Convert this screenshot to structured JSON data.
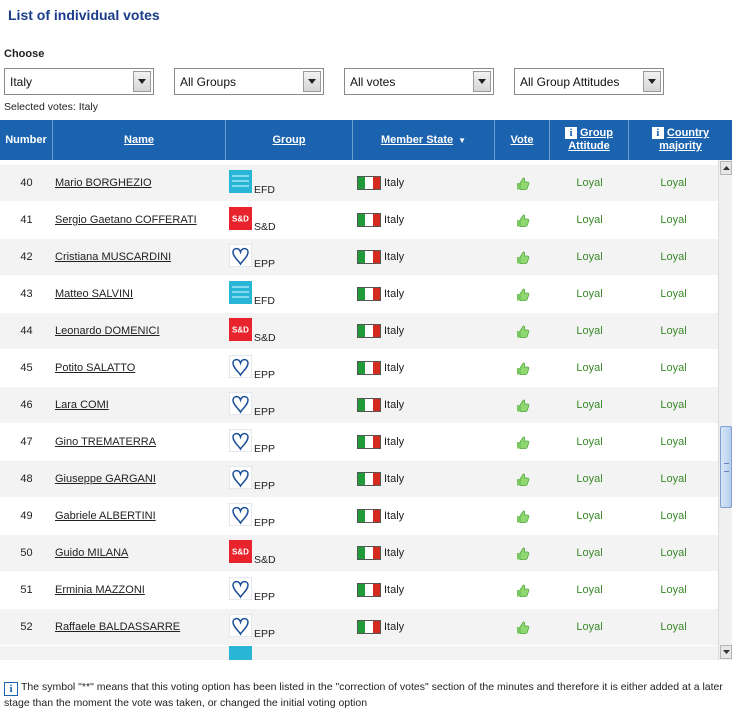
{
  "page": {
    "title": "List of individual votes",
    "choose_label": "Choose",
    "selected_votes": "Selected votes: Italy"
  },
  "filters": {
    "member_state": "Italy",
    "group": "All Groups",
    "votes": "All votes",
    "attitude": "All Group Attitudes"
  },
  "columns": {
    "number": "Number",
    "name": "Name",
    "group": "Group",
    "member_state": "Member State",
    "vote": "Vote",
    "group_attitude": "Group Attitude",
    "country_majority": "Country majority"
  },
  "rows": [
    {
      "number": "40",
      "name": "Mario BORGHEZIO",
      "group": "EFD",
      "member_state": "Italy",
      "vote": "thumbs-up",
      "group_attitude": "Loyal",
      "country_majority": "Loyal"
    },
    {
      "number": "41",
      "name": "Sergio Gaetano COFFERATI",
      "group": "S&D",
      "member_state": "Italy",
      "vote": "thumbs-up",
      "group_attitude": "Loyal",
      "country_majority": "Loyal"
    },
    {
      "number": "42",
      "name": "Cristiana MUSCARDINI",
      "group": "EPP",
      "member_state": "Italy",
      "vote": "thumbs-up",
      "group_attitude": "Loyal",
      "country_majority": "Loyal"
    },
    {
      "number": "43",
      "name": "Matteo SALVINI",
      "group": "EFD",
      "member_state": "Italy",
      "vote": "thumbs-up",
      "group_attitude": "Loyal",
      "country_majority": "Loyal"
    },
    {
      "number": "44",
      "name": "Leonardo DOMENICI",
      "group": "S&D",
      "member_state": "Italy",
      "vote": "thumbs-up",
      "group_attitude": "Loyal",
      "country_majority": "Loyal"
    },
    {
      "number": "45",
      "name": "Potito SALATTO",
      "group": "EPP",
      "member_state": "Italy",
      "vote": "thumbs-up",
      "group_attitude": "Loyal",
      "country_majority": "Loyal"
    },
    {
      "number": "46",
      "name": "Lara COMI",
      "group": "EPP",
      "member_state": "Italy",
      "vote": "thumbs-up",
      "group_attitude": "Loyal",
      "country_majority": "Loyal"
    },
    {
      "number": "47",
      "name": "Gino TREMATERRA",
      "group": "EPP",
      "member_state": "Italy",
      "vote": "thumbs-up",
      "group_attitude": "Loyal",
      "country_majority": "Loyal"
    },
    {
      "number": "48",
      "name": "Giuseppe GARGANI",
      "group": "EPP",
      "member_state": "Italy",
      "vote": "thumbs-up",
      "group_attitude": "Loyal",
      "country_majority": "Loyal"
    },
    {
      "number": "49",
      "name": "Gabriele ALBERTINI",
      "group": "EPP",
      "member_state": "Italy",
      "vote": "thumbs-up",
      "group_attitude": "Loyal",
      "country_majority": "Loyal"
    },
    {
      "number": "50",
      "name": "Guido MILANA",
      "group": "S&D",
      "member_state": "Italy",
      "vote": "thumbs-up",
      "group_attitude": "Loyal",
      "country_majority": "Loyal"
    },
    {
      "number": "51",
      "name": "Erminia MAZZONI",
      "group": "EPP",
      "member_state": "Italy",
      "vote": "thumbs-up",
      "group_attitude": "Loyal",
      "country_majority": "Loyal"
    },
    {
      "number": "52",
      "name": "Raffaele BALDASSARRE",
      "group": "EPP",
      "member_state": "Italy",
      "vote": "thumbs-up",
      "group_attitude": "Loyal",
      "country_majority": "Loyal"
    }
  ],
  "footnote": "The symbol \"**\" means that this voting option has been listed in the \"correction of votes\" section of the minutes and therefore it is either added at a later stage than the moment the vote was taken, or changed the initial voting option",
  "colors": {
    "header_bg": "#1b63ae",
    "title": "#1a3c8a",
    "loyal": "#3a8a2a",
    "efd": "#29b6d6",
    "sd": "#e8232b",
    "epp": "#1b4f9a"
  },
  "icons": {
    "vote_yes": "thumbs-up-icon",
    "info": "info-icon",
    "flag": "italy-flag-icon"
  }
}
